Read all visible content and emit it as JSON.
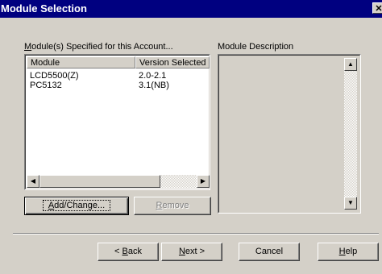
{
  "window": {
    "title": "Module Selection",
    "close_glyph": "✕"
  },
  "modules_group": {
    "label_accel": "M",
    "label_rest": "odule(s) Specified for this Account...",
    "columns": [
      "Module",
      "Version Selected"
    ],
    "rows": [
      {
        "module": "LCD5500(Z)",
        "version": "2.0-2.1"
      },
      {
        "module": "PC5132",
        "version": "3.1(NB)"
      }
    ]
  },
  "description_group": {
    "label": "Module Description",
    "text": ""
  },
  "buttons": {
    "add_change_accel": "A",
    "add_change_rest": "dd/Change...",
    "remove_accel": "R",
    "remove_rest": "emove",
    "back_prefix": "< ",
    "back_accel": "B",
    "back_rest": "ack",
    "next_accel": "N",
    "next_rest": "ext >",
    "cancel": "Cancel",
    "help_accel": "H",
    "help_rest": "elp"
  },
  "icons": {
    "scroll_left": "◀",
    "scroll_right": "▶",
    "scroll_up": "▲",
    "scroll_down": "▼"
  }
}
